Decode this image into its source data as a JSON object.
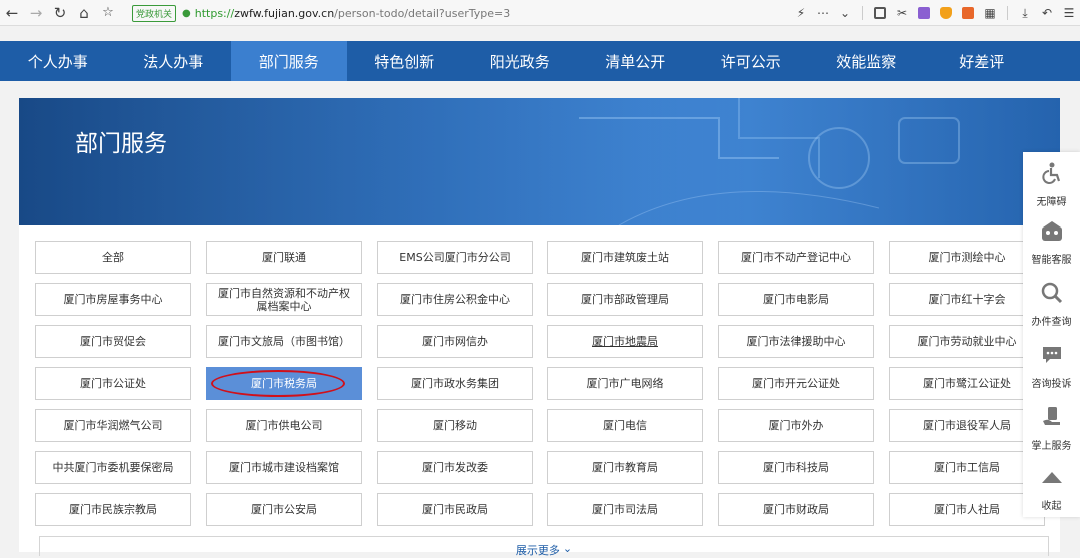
{
  "browser": {
    "badge": "党政机关",
    "url_scheme": "https://",
    "url_host": "zwfw.fujian.gov.cn",
    "url_path": "/person-todo/detail?userType=3"
  },
  "nav": [
    {
      "label": "个人办事"
    },
    {
      "label": "法人办事"
    },
    {
      "label": "部门服务"
    },
    {
      "label": "特色创新"
    },
    {
      "label": "阳光政务"
    },
    {
      "label": "清单公开"
    },
    {
      "label": "许可公示"
    },
    {
      "label": "效能监察"
    },
    {
      "label": "好差评"
    }
  ],
  "active_nav": "部门服务",
  "banner": {
    "title": "部门服务"
  },
  "departments": [
    [
      "全部",
      "厦门联通",
      "EMS公司厦门市分公司",
      "厦门市建筑废土站",
      "厦门市不动产登记中心",
      "厦门市测绘中心"
    ],
    [
      "厦门市房屋事务中心",
      "厦门市自然资源和不动产权属档案中心",
      "厦门市住房公积金中心",
      "厦门市部政管理局",
      "厦门市电影局",
      "厦门市红十字会"
    ],
    [
      "厦门市贸促会",
      "厦门市文旅局（市图书馆）",
      "厦门市网信办",
      "厦门市地震局",
      "厦门市法律援助中心",
      "厦门市劳动就业中心"
    ],
    [
      "厦门市公证处",
      "厦门市税务局",
      "厦门市政水务集团",
      "厦门市广电网络",
      "厦门市开元公证处",
      "厦门市鹭江公证处"
    ],
    [
      "厦门市华润燃气公司",
      "厦门市供电公司",
      "厦门移动",
      "厦门电信",
      "厦门市外办",
      "厦门市退役军人局"
    ],
    [
      "中共厦门市委机要保密局",
      "厦门市城市建设档案馆",
      "厦门市发改委",
      "厦门市教育局",
      "厦门市科技局",
      "厦门市工信局"
    ],
    [
      "厦门市民族宗教局",
      "厦门市公安局",
      "厦门市民政局",
      "厦门市司法局",
      "厦门市财政局",
      "厦门市人社局"
    ]
  ],
  "selected_department": "厦门市税务局",
  "more_label": "展示更多",
  "sidebar": [
    {
      "label": "无障碍",
      "icon": "wheelchair-icon"
    },
    {
      "label": "智能客服",
      "icon": "robot-icon"
    },
    {
      "label": "办件查询",
      "icon": "search-icon"
    },
    {
      "label": "咨询投诉",
      "icon": "chat-icon"
    },
    {
      "label": "掌上服务",
      "icon": "hand-phone-icon"
    },
    {
      "label": "收起",
      "icon": "collapse-up-icon"
    }
  ],
  "colors": {
    "nav_bg": "#1e5da7",
    "nav_active": "#3b7fcf",
    "selected_cell": "#5b8fd8",
    "highlight_ring": "#d0101a"
  }
}
